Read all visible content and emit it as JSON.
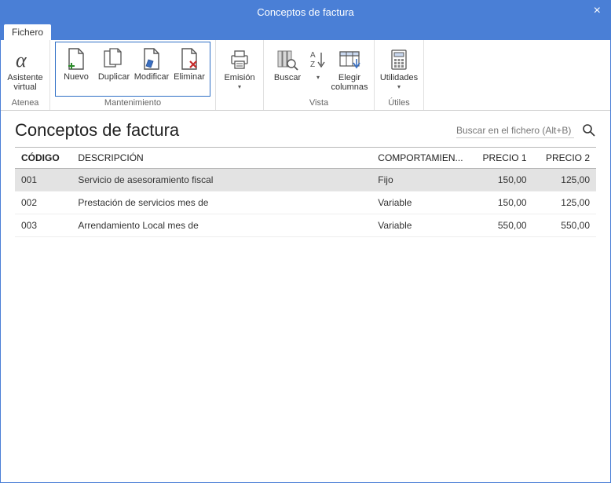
{
  "window": {
    "title": "Conceptos de factura"
  },
  "tabs": {
    "fichero": "Fichero"
  },
  "ribbon": {
    "atenea": {
      "label1": "Asistente",
      "label2": "virtual",
      "group": "Atenea"
    },
    "mantenimiento": {
      "nuevo": "Nuevo",
      "duplicar": "Duplicar",
      "modificar": "Modificar",
      "eliminar": "Eliminar",
      "group": "Mantenimiento"
    },
    "emision": {
      "label": "Emisión",
      "group": ""
    },
    "vista": {
      "buscar": "Buscar",
      "ordenar": "",
      "elegir1": "Elegir",
      "elegir2": "columnas",
      "group": "Vista"
    },
    "utiles": {
      "label": "Utilidades",
      "group": "Útiles"
    }
  },
  "page": {
    "title": "Conceptos de factura",
    "search_placeholder": "Buscar en el fichero (Alt+B)"
  },
  "table": {
    "headers": {
      "codigo": "CÓDIGO",
      "descripcion": "DESCRIPCIÓN",
      "comportamiento": "COMPORTAMIEN...",
      "precio1": "PRECIO 1",
      "precio2": "PRECIO 2"
    },
    "rows": [
      {
        "codigo": "001",
        "descripcion": "Servicio de asesoramiento fiscal",
        "comportamiento": "Fijo",
        "precio1": "150,00",
        "precio2": "125,00",
        "selected": true
      },
      {
        "codigo": "002",
        "descripcion": "Prestación de servicios mes de",
        "comportamiento": "Variable",
        "precio1": "150,00",
        "precio2": "125,00",
        "selected": false
      },
      {
        "codigo": "003",
        "descripcion": "Arrendamiento Local mes de",
        "comportamiento": "Variable",
        "precio1": "550,00",
        "precio2": "550,00",
        "selected": false
      }
    ]
  }
}
